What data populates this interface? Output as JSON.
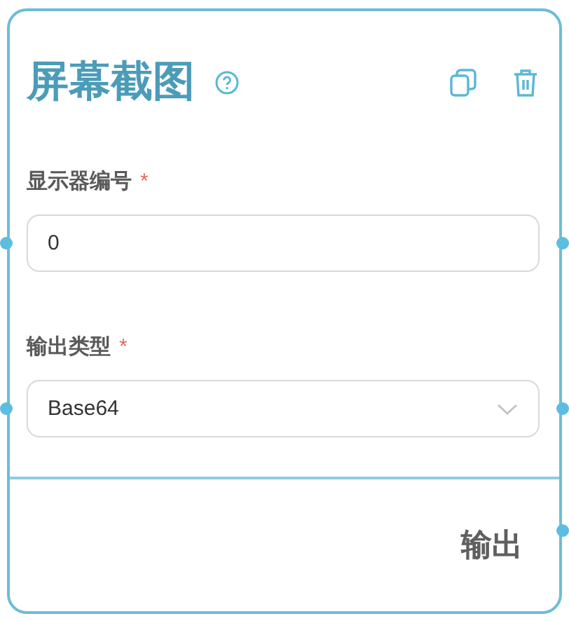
{
  "node": {
    "title": "屏幕截图"
  },
  "fields": [
    {
      "label": "显示器编号",
      "required_mark": "*",
      "kind": "text",
      "value": "0"
    },
    {
      "label": "输出类型",
      "required_mark": "*",
      "kind": "select",
      "value": "Base64"
    }
  ],
  "output": {
    "label": "输出"
  }
}
